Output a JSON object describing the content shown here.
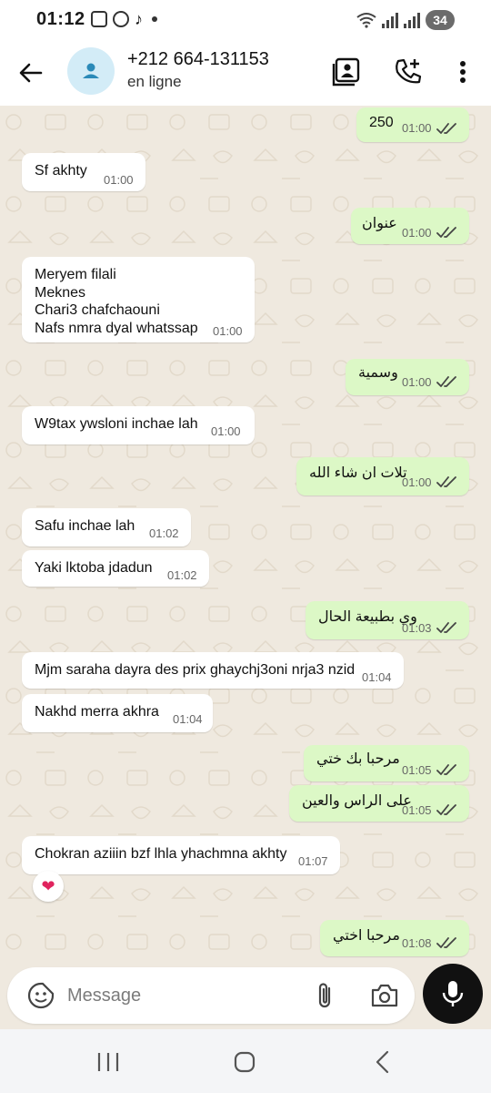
{
  "status_bar": {
    "time": "01:12",
    "battery": "34",
    "icons": [
      "screenshot-icon",
      "whatsapp-icon",
      "tiktok-icon",
      "notification-dot-icon",
      "wifi-icon",
      "signal-icon",
      "signal-icon",
      "battery-icon"
    ]
  },
  "header": {
    "contact_name": "+212 664-131153",
    "contact_status": "en ligne",
    "icons": [
      "back-arrow-icon",
      "contact-avatar-icon",
      "contact-card-icon",
      "add-call-icon",
      "more-vertical-icon"
    ]
  },
  "messages": [
    {
      "dir": "out",
      "text": "250",
      "time": "01:00",
      "ticks": "read"
    },
    {
      "dir": "in",
      "text": "Sf akhty",
      "time": "01:00"
    },
    {
      "dir": "out",
      "text": "عنوان",
      "time": "01:00",
      "ticks": "read"
    },
    {
      "dir": "in",
      "text": "Meryem filali\nMeknes\nChari3 chafchaouni\nNafs nmra dyal whatssap",
      "time": "01:00"
    },
    {
      "dir": "out",
      "text": "وسمية",
      "time": "01:00",
      "ticks": "read"
    },
    {
      "dir": "in",
      "text": "W9tax ywsloni inchae lah",
      "time": "01:00"
    },
    {
      "dir": "out",
      "text": "تلات ان شاء الله",
      "time": "01:00",
      "ticks": "read"
    },
    {
      "dir": "in",
      "text": "Safu inchae lah",
      "time": "01:02"
    },
    {
      "dir": "in",
      "text": "Yaki lktoba jdadun",
      "time": "01:02"
    },
    {
      "dir": "out",
      "text": "وي بطبيعة الحال",
      "time": "01:03",
      "ticks": "read"
    },
    {
      "dir": "in",
      "text": "Mjm saraha dayra des prix ghaychj3oni nrja3 nzid",
      "time": "01:04"
    },
    {
      "dir": "in",
      "text": "Nakhd merra akhra",
      "time": "01:04"
    },
    {
      "dir": "out",
      "text": "مرحبا بك ختي",
      "time": "01:05",
      "ticks": "read"
    },
    {
      "dir": "out",
      "text": "على الراس والعين",
      "time": "01:05",
      "ticks": "read"
    },
    {
      "dir": "in",
      "text": "Chokran aziiin bzf lhla yhachmna akhty",
      "time": "01:07",
      "reaction": "❤"
    },
    {
      "dir": "out",
      "text": "مرحبا اختي",
      "time": "01:08",
      "ticks": "read"
    }
  ],
  "composer": {
    "placeholder": "Message",
    "icons": [
      "sticker-icon",
      "attachment-icon",
      "camera-icon",
      "microphone-icon"
    ]
  },
  "navbar": {
    "icons": [
      "recent-apps-icon",
      "home-icon",
      "back-icon"
    ]
  },
  "colors": {
    "chat_background": "#efe9df",
    "incoming_bubble": "#ffffff",
    "outgoing_bubble": "#dcf8c6",
    "read_ticks": "#444444",
    "avatar_bg": "#d3ecf7",
    "avatar_icon": "#2b8ab8"
  }
}
